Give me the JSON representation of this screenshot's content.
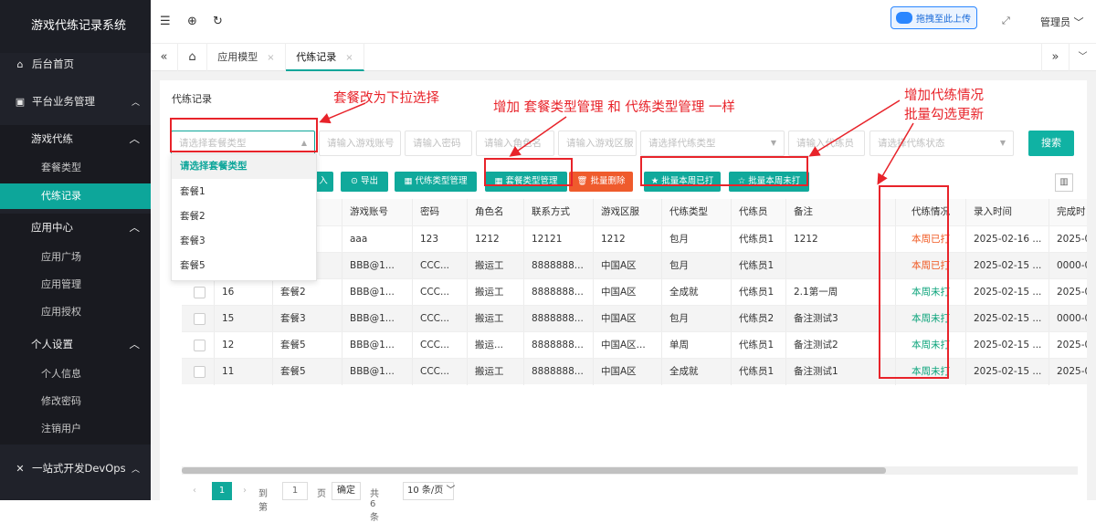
{
  "sidebar": {
    "title": "游戏代练记录系统",
    "home": "后台首页",
    "business": "平台业务管理",
    "groups": [
      "游戏代练",
      "应用中心",
      "个人设置"
    ],
    "game_items": [
      "套餐类型",
      "代练记录"
    ],
    "app_items": [
      "应用广场",
      "应用管理",
      "应用授权"
    ],
    "personal_items": [
      "个人信息",
      "修改密码",
      "注销用户"
    ],
    "devops": "一站式开发DevOps"
  },
  "topbar": {
    "upload": "拖拽至此上传",
    "admin": "管理员"
  },
  "tabs": [
    "应用模型",
    "代练记录"
  ],
  "panel_title": "代练记录",
  "filters": {
    "package_type": "请选择套餐类型",
    "game_account": "请输入游戏账号",
    "password": "请输入密码",
    "role": "请输入角色名",
    "server": "请输入游戏区服",
    "boost_type": "请选择代练类型",
    "booster": "请输入代练员",
    "status": "请选择代练状态",
    "search": "搜索"
  },
  "toolbar": {
    "add": "入",
    "export": "导出",
    "boost_type_mgmt": "代练类型管理",
    "package_type_mgmt": "套餐类型管理",
    "batch_delete": "批量删除",
    "batch_done": "批量本周已打",
    "batch_undone": "批量本周未打"
  },
  "dropdown": [
    "请选择套餐类型",
    "套餐1",
    "套餐2",
    "套餐3",
    "套餐5"
  ],
  "columns": [
    "",
    "",
    "",
    "游戏账号",
    "密码",
    "角色名",
    "联系方式",
    "游戏区服",
    "代练类型",
    "代练员",
    "备注",
    "代练情况",
    "录入时间",
    "完成时"
  ],
  "rows": [
    {
      "id": "",
      "pkg": "",
      "account": "aaa",
      "pwd": "123",
      "role": "1212",
      "contact": "12121",
      "server": "1212",
      "type": "包月",
      "booster": "代练员1",
      "note": "1212",
      "status": "本周已打",
      "time": "2025-02-16 ...",
      "done": "2025-0"
    },
    {
      "id": "",
      "pkg": "",
      "account": "BBB@1...",
      "pwd": "CCC...",
      "role": "搬运工",
      "contact": "8888888...",
      "server": "中国A区",
      "type": "包月",
      "booster": "代练员1",
      "note": "",
      "status": "本周已打",
      "time": "2025-02-15 ...",
      "done": "0000-0"
    },
    {
      "id": "16",
      "pkg": "套餐2",
      "account": "BBB@1...",
      "pwd": "CCC...",
      "role": "搬运工",
      "contact": "8888888...",
      "server": "中国A区",
      "type": "全成就",
      "booster": "代练员1",
      "note": "2.1第一周",
      "status": "本周未打",
      "time": "2025-02-15 ...",
      "done": "2025-0"
    },
    {
      "id": "15",
      "pkg": "套餐3",
      "account": "BBB@1...",
      "pwd": "CCC...",
      "role": "搬运工",
      "contact": "8888888...",
      "server": "中国A区",
      "type": "包月",
      "booster": "代练员2",
      "note": "备注测试3",
      "status": "本周未打",
      "time": "2025-02-15 ...",
      "done": "0000-0"
    },
    {
      "id": "12",
      "pkg": "套餐5",
      "account": "BBB@1...",
      "pwd": "CCC...",
      "role": "搬运...",
      "contact": "8888888...",
      "server": "中国A区...",
      "type": "单周",
      "booster": "代练员1",
      "note": "备注测试2",
      "status": "本周未打",
      "time": "2025-02-15 ...",
      "done": "2025-0"
    },
    {
      "id": "11",
      "pkg": "套餐5",
      "account": "BBB@1...",
      "pwd": "CCC...",
      "role": "搬运工",
      "contact": "8888888...",
      "server": "中国A区",
      "type": "全成就",
      "booster": "代练员1",
      "note": "备注测试1",
      "status": "本周未打",
      "time": "2025-02-15 ...",
      "done": "2025-0"
    }
  ],
  "pager": {
    "page": "1",
    "goto": "到第",
    "input": "1",
    "unit": "页",
    "confirm": "确定",
    "total": "共 6 条",
    "per_page": "10 条/页"
  },
  "annotations": {
    "dropdown_note": "套餐改为下拉选择",
    "mgmt_note": "增加 套餐类型管理 和 代练类型管理 一样",
    "status_note_1": "增加代练情况",
    "status_note_2": "批量勾选更新"
  },
  "colors": {
    "sidebar": "#20222a",
    "accent": "#0da69a",
    "danger": "#ef5b2c",
    "annotation": "#e8232a"
  }
}
